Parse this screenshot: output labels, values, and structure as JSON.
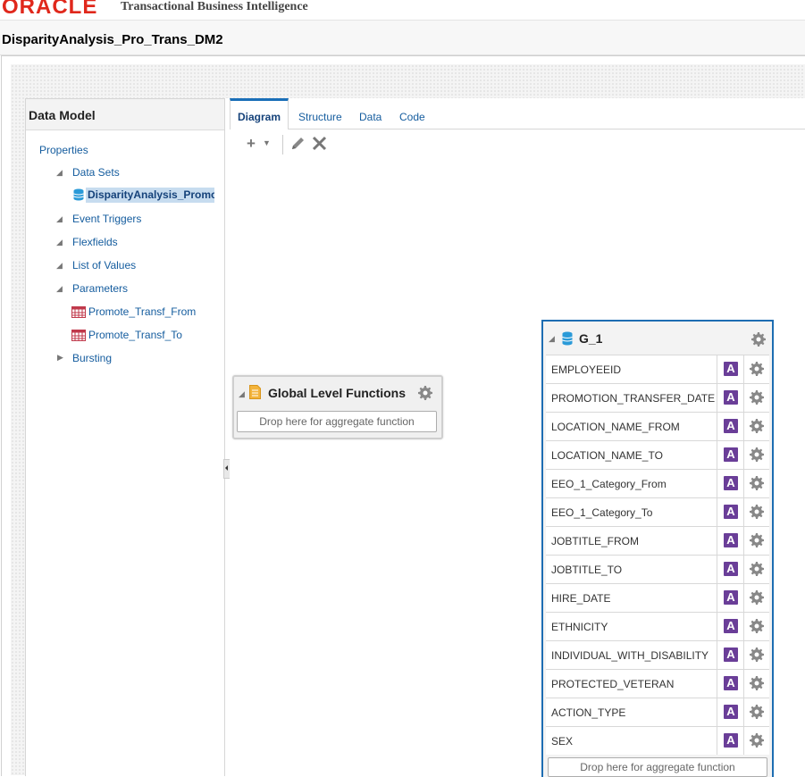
{
  "header": {
    "brand": "ORACLE",
    "app_name": "Transactional Business Intelligence"
  },
  "page_title": "DisparityAnalysis_Pro_Trans_DM2",
  "left_panel": {
    "title": "Data Model",
    "properties": "Properties",
    "items": {
      "data_sets": "Data Sets",
      "dataset_name": "DisparityAnalysis_Promc",
      "event_triggers": "Event Triggers",
      "flexfields": "Flexfields",
      "list_of_values": "List of Values",
      "parameters": "Parameters",
      "param_from": "Promote_Transf_From",
      "param_to": "Promote_Transf_To",
      "bursting": "Bursting"
    }
  },
  "tabs": {
    "diagram": "Diagram",
    "structure": "Structure",
    "data": "Data",
    "code": "Code"
  },
  "toolbar": {
    "add_icon": "plus-icon",
    "edit_icon": "pencil-icon",
    "delete_icon": "close-icon"
  },
  "global_functions": {
    "title": "Global Level Functions",
    "drop_placeholder": "Drop here for aggregate function"
  },
  "group": {
    "title": "G_1",
    "columns": [
      "EMPLOYEEID",
      "PROMOTION_TRANSFER_DATE",
      "LOCATION_NAME_FROM",
      "LOCATION_NAME_TO",
      "EEO_1_Category_From",
      "EEO_1_Category_To",
      "JOBTITLE_FROM",
      "JOBTITLE_TO",
      "HIRE_DATE",
      "ETHNICITY",
      "INDIVIDUAL_WITH_DISABILITY",
      "PROTECTED_VETERAN",
      "ACTION_TYPE",
      "SEX"
    ],
    "type_badge": "A",
    "drop_placeholder": "Drop here for aggregate function"
  },
  "colors": {
    "oracle_red": "#e0281c",
    "link_blue": "#145c9e",
    "group_border": "#1d6db2",
    "badge_purple": "#6a3e98"
  }
}
